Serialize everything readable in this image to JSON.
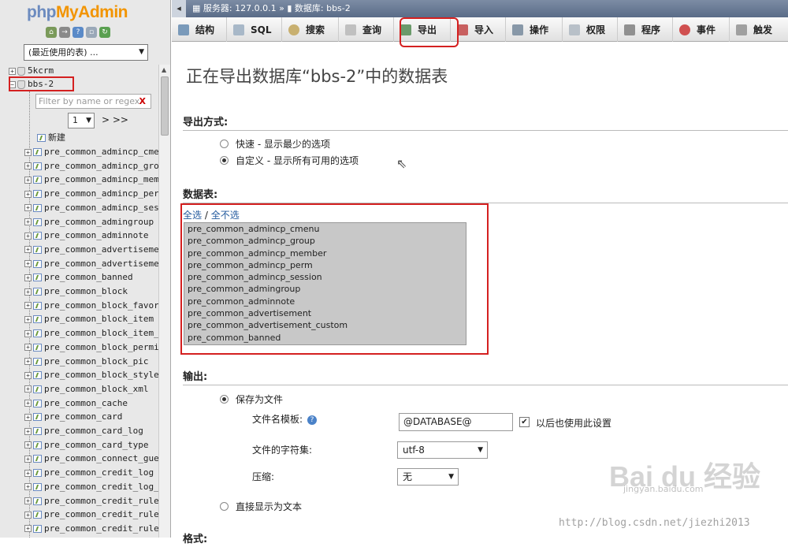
{
  "logo": {
    "php": "php",
    "my": "MyAdmin"
  },
  "left": {
    "recent_select": "(最近使用的表) ...",
    "databases": [
      "5kcrm",
      "bbs-2"
    ],
    "filter_placeholder": "Filter by name or regex",
    "pager_value": "1",
    "pager_nav": "> >>",
    "new_label": "新建",
    "tables": [
      "pre_common_admincp_cmenu",
      "pre_common_admincp_group",
      "pre_common_admincp_member",
      "pre_common_admincp_perm",
      "pre_common_admincp_session",
      "pre_common_admingroup",
      "pre_common_adminnote",
      "pre_common_advertisement",
      "pre_common_advertisement_custom",
      "pre_common_banned",
      "pre_common_block",
      "pre_common_block_favorite",
      "pre_common_block_item",
      "pre_common_block_item_data",
      "pre_common_block_permission",
      "pre_common_block_pic",
      "pre_common_block_style",
      "pre_common_block_xml",
      "pre_common_cache",
      "pre_common_card",
      "pre_common_card_log",
      "pre_common_card_type",
      "pre_common_connect_guest",
      "pre_common_credit_log",
      "pre_common_credit_log_field",
      "pre_common_credit_rule",
      "pre_common_credit_rule_log",
      "pre_common_credit_rule_log_field"
    ]
  },
  "breadcrumb": {
    "server": "服务器: 127.0.0.1",
    "sep": "»",
    "database": "数据库: bbs-2"
  },
  "tabs": [
    "结构",
    "SQL",
    "搜索",
    "查询",
    "导出",
    "导入",
    "操作",
    "权限",
    "程序",
    "事件",
    "触发"
  ],
  "main": {
    "title": "正在导出数据库“bbs-2”中的数据表",
    "export_method_heading": "导出方式:",
    "method_quick": "快速 - 显示最少的选项",
    "method_custom": "自定义 - 显示所有可用的选项",
    "tables_heading": "数据表:",
    "select_all": "全选",
    "select_sep": " / ",
    "select_none": "全不选",
    "table_list": [
      "pre_common_admincp_cmenu",
      "pre_common_admincp_group",
      "pre_common_admincp_member",
      "pre_common_admincp_perm",
      "pre_common_admincp_session",
      "pre_common_admingroup",
      "pre_common_adminnote",
      "pre_common_advertisement",
      "pre_common_advertisement_custom",
      "pre_common_banned"
    ],
    "output_heading": "输出:",
    "save_as_file": "保存为文件",
    "filename_template_label": "文件名模板:",
    "filename_template_value": "@DATABASE@",
    "remember_label": "以后也使用此设置",
    "charset_label": "文件的字符集:",
    "charset_value": "utf-8",
    "compression_label": "压缩:",
    "compression_value": "无",
    "show_as_text": "直接显示为文本",
    "format_heading_partial": "格式:"
  },
  "watermark": {
    "brand": "Bai du 经验",
    "url": "jingyan.baidu.com",
    "blog": "http://blog.csdn.net/jiezhi2013"
  },
  "colors": {
    "highlight_box": "#d42020",
    "topbar": "#6a7a96",
    "logo_php": "#6c8bbf",
    "logo_myadmin": "#f29400"
  }
}
